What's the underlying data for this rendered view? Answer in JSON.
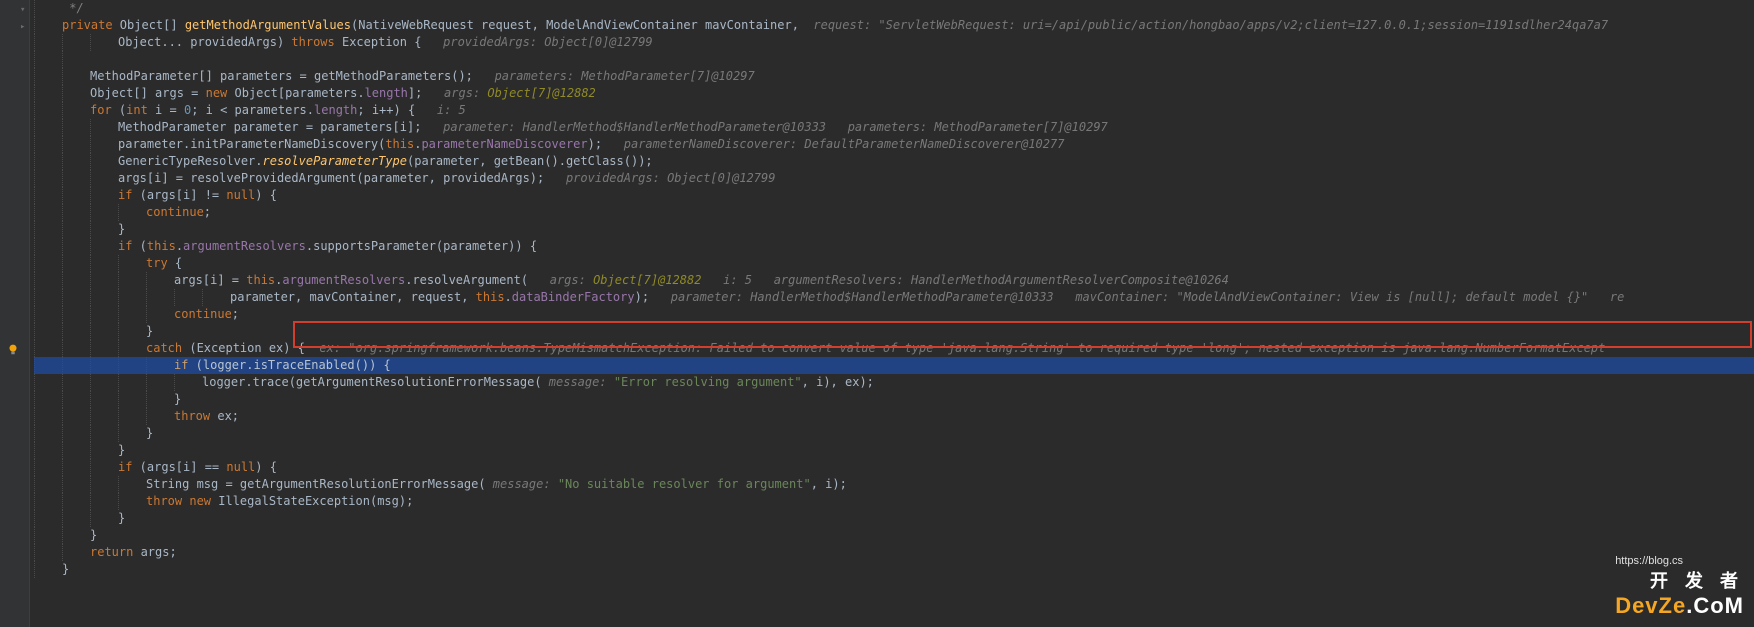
{
  "colors": {
    "bg": "#2b2b2b",
    "highlight": "#214283",
    "boxBorder": "#d13e2e"
  },
  "watermark": {
    "url": "https://blog.cs",
    "logo_pre": "开 发 者",
    "logo_accent": "DevZe",
    "logo_suffix": ".CoM"
  },
  "code": {
    "l1": " */",
    "l2_kw": "private",
    "l2_type": " Object[] ",
    "l2_method": "getMethodArgumentValues",
    "l2_params": "(NativeWebRequest request, ModelAndViewContainer mavContainer,",
    "l2_inlay": "  request: \"ServletWebRequest: uri=/api/public/action/hongbao/apps/v2;client=127.0.0.1;session=1191sdlher24qa7a7",
    "l3_txt": "Object... providedArgs) ",
    "l3_kw": "throws",
    "l3_txt2": " Exception {",
    "l3_inlay": "   providedArgs: Object[0]@12799",
    "l5_txt": "MethodParameter[] parameters = getMethodParameters();",
    "l5_inlay": "   parameters: MethodParameter[7]@10297",
    "l6_txt1": "Object[] args = ",
    "l6_kw": "new",
    "l6_txt2": " Object[parameters.",
    "l6_field": "length",
    "l6_txt3": "];",
    "l6_inlay1": "   args: ",
    "l6_inlay_val": "Object[7]@12882",
    "l7_kw": "for",
    "l7_txt1": " (",
    "l7_kw2": "int",
    "l7_txt2": " i = ",
    "l7_num": "0",
    "l7_txt3": "; i < parameters.",
    "l7_field": "length",
    "l7_txt4": "; i++) {",
    "l7_inlay": "   i: 5",
    "l8_txt": "MethodParameter parameter = parameters[i];",
    "l8_inlay": "   parameter: HandlerMethod$HandlerMethodParameter@10333   parameters: MethodParameter[7]@10297",
    "l9_txt1": "parameter.initParameterNameDiscovery(",
    "l9_kw": "this",
    "l9_txt2": ".",
    "l9_field": "parameterNameDiscoverer",
    "l9_txt3": ");",
    "l9_inlay": "   parameterNameDiscoverer: DefaultParameterNameDiscoverer@10277",
    "l10_txt1": "GenericTypeResolver.",
    "l10_method": "resolveParameterType",
    "l10_txt2": "(parameter, getBean().getClass());",
    "l11_txt": "args[i] = resolveProvidedArgument(parameter, providedArgs);",
    "l11_inlay": "   providedArgs: Object[0]@12799",
    "l12_kw": "if",
    "l12_txt": " (args[i] != ",
    "l12_kw2": "null",
    "l12_txt2": ") {",
    "l13_kw": "continue",
    "l13_txt": ";",
    "l14_txt": "}",
    "l15_kw": "if",
    "l15_txt1": " (",
    "l15_kw2": "this",
    "l15_txt2": ".",
    "l15_field": "argumentResolvers",
    "l15_txt3": ".supportsParameter(parameter)) {",
    "l16_kw": "try",
    "l16_txt": " {",
    "l17_txt1": "args[i] = ",
    "l17_kw": "this",
    "l17_txt2": ".",
    "l17_field": "argumentResolvers",
    "l17_txt3": ".resolveArgument(",
    "l17_inlay1": "   args: ",
    "l17_inlay_val": "Object[7]@12882",
    "l17_inlay2": "   i: 5   argumentResolvers: HandlerMethodArgumentResolverComposite@10264",
    "l18_txt1": "parameter, mavContainer, request, ",
    "l18_kw": "this",
    "l18_txt2": ".",
    "l18_field": "dataBinderFactory",
    "l18_txt3": ");",
    "l18_inlay": "   parameter: HandlerMethod$HandlerMethodParameter@10333   mavContainer: \"ModelAndViewContainer: View is [null]; default model {}\"   re",
    "l19_kw": "continue",
    "l19_txt": ";",
    "l20_txt": "}",
    "l21_kw": "catch",
    "l21_txt": " (Exception ex) {",
    "l21_inlay": "  ex: \"org.springframework.beans.TypeMismatchException: Failed to convert value of type 'java.lang.String' to required type 'long'; nested exception is java.lang.NumberFormatExcept",
    "l22_kw": "if",
    "l22_txt": " (logger.isTraceEnabled()) {",
    "l23_txt1": "logger.trace(getArgumentResolutionErrorMessage(",
    "l23_inlay": " message: ",
    "l23_str": "\"Error resolving argument\"",
    "l23_txt2": ", i), ex);",
    "l24_txt": "}",
    "l25_kw": "throw",
    "l25_txt": " ex;",
    "l26_txt": "}",
    "l27_txt": "}",
    "l28_kw": "if",
    "l28_txt1": " (args[i] == ",
    "l28_kw2": "null",
    "l28_txt2": ") {",
    "l29_txt1": "String msg = getArgumentResolutionErrorMessage(",
    "l29_inlay": " message: ",
    "l29_str": "\"No suitable resolver for argument\"",
    "l29_txt2": ", i);",
    "l30_kw": "throw new",
    "l30_txt": " IllegalStateException(msg);",
    "l31_txt": "}",
    "l32_txt": "}",
    "l33_kw": "return",
    "l33_txt": " args;",
    "l34_txt": "}"
  }
}
